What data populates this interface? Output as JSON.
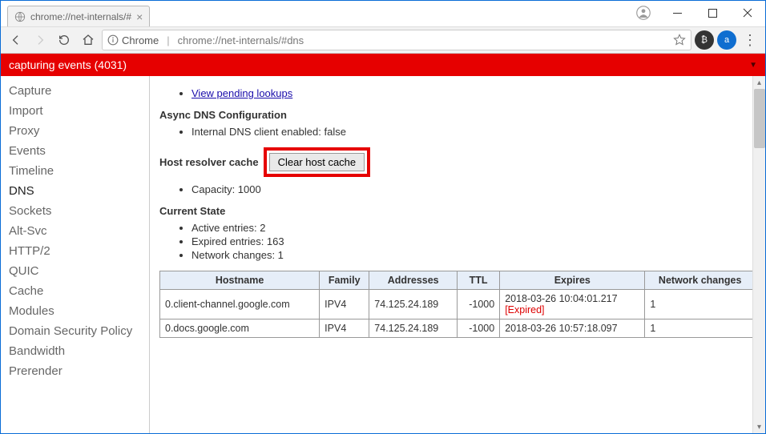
{
  "window": {
    "title": "chrome://net-internals/#"
  },
  "omnibox": {
    "prefix": "Chrome",
    "url": "chrome://net-internals/#dns"
  },
  "redbar": {
    "text": "capturing events (4031)"
  },
  "sidebar": {
    "items": [
      "Capture",
      "Import",
      "Proxy",
      "Events",
      "Timeline",
      "DNS",
      "Sockets",
      "Alt-Svc",
      "HTTP/2",
      "QUIC",
      "Cache",
      "Modules",
      "Domain Security Policy",
      "Bandwidth",
      "Prerender"
    ],
    "active": "DNS"
  },
  "main": {
    "pending_link": "View pending lookups",
    "async_heading": "Async DNS Configuration",
    "async_item": "Internal DNS client enabled: false",
    "host_resolver_label": "Host resolver cache",
    "clear_button": "Clear host cache",
    "capacity_item": "Capacity: 1000",
    "current_state_heading": "Current State",
    "state_items": [
      "Active entries: 2",
      "Expired entries: 163",
      "Network changes: 1"
    ],
    "table": {
      "headers": [
        "Hostname",
        "Family",
        "Addresses",
        "TTL",
        "Expires",
        "Network changes"
      ],
      "rows": [
        {
          "hostname": "0.client-channel.google.com",
          "family": "IPV4",
          "addresses": "74.125.24.189",
          "ttl": "-1000",
          "expires": "2018-03-26 10:04:01.217",
          "expired": true,
          "net": "1"
        },
        {
          "hostname": "0.docs.google.com",
          "family": "IPV4",
          "addresses": "74.125.24.189",
          "ttl": "-1000",
          "expires": "2018-03-26 10:57:18.097",
          "expired": false,
          "net": "1"
        }
      ],
      "expired_tag": "[Expired]"
    }
  }
}
